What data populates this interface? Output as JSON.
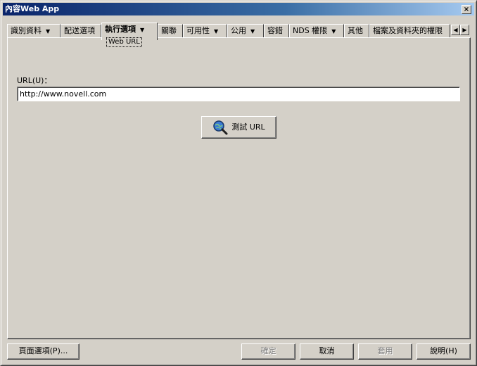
{
  "window": {
    "title": "內容Web App",
    "close_glyph": "×"
  },
  "tabs": [
    {
      "label": "識別資料",
      "dropdown": true
    },
    {
      "label": "配送選項",
      "dropdown": false
    },
    {
      "label": "執行選項",
      "dropdown": true,
      "active": true
    },
    {
      "label": "關聯",
      "dropdown": false
    },
    {
      "label": "可用性",
      "dropdown": true
    },
    {
      "label": "公用",
      "dropdown": true
    },
    {
      "label": "容錯",
      "dropdown": false
    },
    {
      "label": "NDS 權限",
      "dropdown": true
    },
    {
      "label": "其他",
      "dropdown": false
    },
    {
      "label": "檔案及資料夾的權限",
      "dropdown": false
    }
  ],
  "active_subtab": "Web URL",
  "tab_arrow": "▼",
  "scroll": {
    "left": "◀",
    "right": "▶"
  },
  "url": {
    "label": "URL(U)：",
    "value": "http://www.novell.com"
  },
  "test_button": {
    "label": "測試 URL",
    "icon": "magnifier-globe-icon"
  },
  "footer": {
    "page_options": "頁面選項(P)...",
    "ok": "確定",
    "cancel": "取消",
    "apply": "套用",
    "help": "說明(H)"
  }
}
